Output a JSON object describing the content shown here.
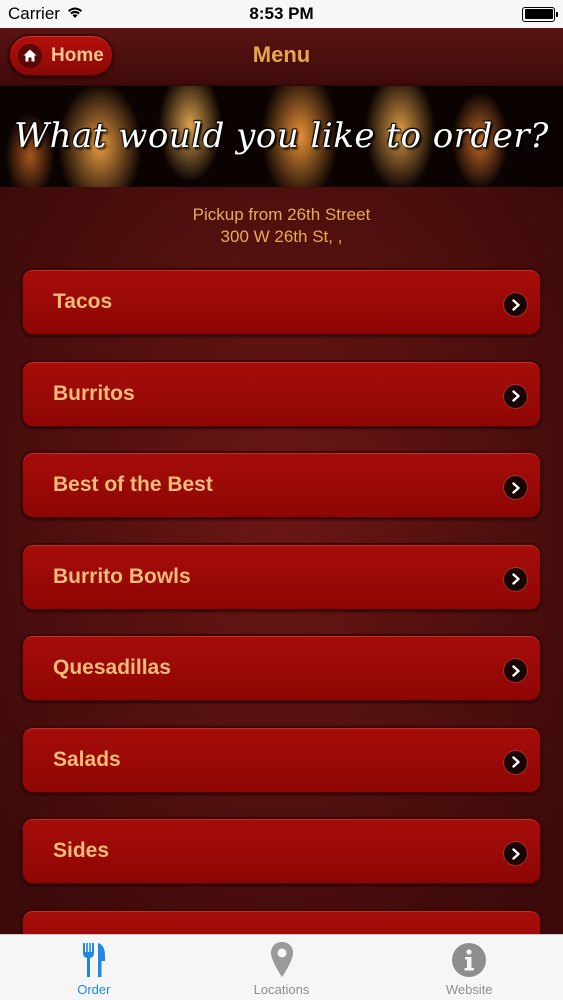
{
  "status_bar": {
    "carrier": "Carrier",
    "time": "8:53 PM"
  },
  "nav": {
    "home_label": "Home",
    "title": "Menu"
  },
  "banner": {
    "text": "What would you like to order?"
  },
  "pickup": {
    "line1": "Pickup from 26th Street",
    "line2": "300 W 26th St, ,"
  },
  "menu": {
    "items": [
      {
        "label": "Tacos"
      },
      {
        "label": "Burritos"
      },
      {
        "label": "Best of the Best"
      },
      {
        "label": "Burrito Bowls"
      },
      {
        "label": "Quesadillas"
      },
      {
        "label": "Salads"
      },
      {
        "label": "Sides"
      },
      {
        "label": ""
      }
    ]
  },
  "tab_bar": {
    "tabs": [
      {
        "label": "Order",
        "icon": "fork-knife-icon",
        "active": true
      },
      {
        "label": "Locations",
        "icon": "location-pin-icon",
        "active": false
      },
      {
        "label": "Website",
        "icon": "info-icon",
        "active": false
      }
    ]
  },
  "colors": {
    "accent_gold": "#e8a64b",
    "button_red": "#a60d0a",
    "background": "#4a0e0d",
    "tab_active": "#1e88e5"
  }
}
